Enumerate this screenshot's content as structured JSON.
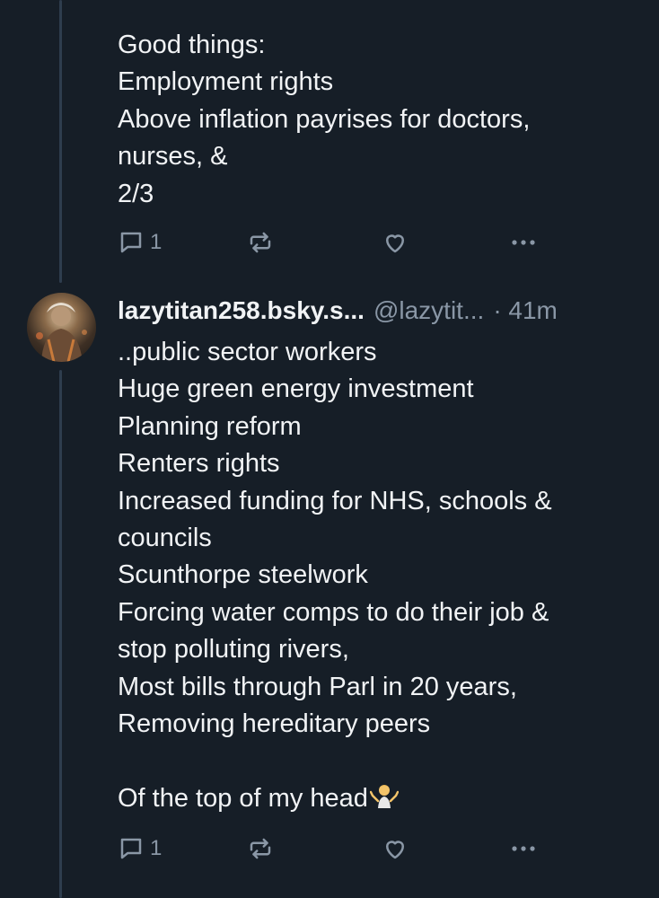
{
  "thread": {
    "post1": {
      "text": "Good things:\nEmployment rights\nAbove inflation payrises for doctors,\nnurses, &\n2/3",
      "reply_count": "1"
    },
    "post2": {
      "display_name": "lazytitan258.bsky.s...",
      "handle": "@lazytit...",
      "timestamp": "· 41m",
      "text": "..public sector workers\nHuge green energy investment\nPlanning reform\nRenters rights\nIncreased funding for NHS, schools &\ncouncils\nScunthorpe steelwork\nForcing water comps to do their job &\nstop polluting rivers,\nMost bills through Parl in 20 years,\nRemoving hereditary peers\n\nOf the top of my head",
      "emoji": "person-shrugging-emoji",
      "reply_count": "1"
    }
  },
  "icons": {
    "reply": "speech-bubble-icon",
    "repost": "repost-arrows-icon",
    "like": "heart-icon",
    "more": "ellipsis-icon"
  },
  "colors": {
    "background": "#161e27",
    "text": "#f1f3f5",
    "muted": "#8a97a6",
    "thread_line": "#2e3d4e"
  }
}
